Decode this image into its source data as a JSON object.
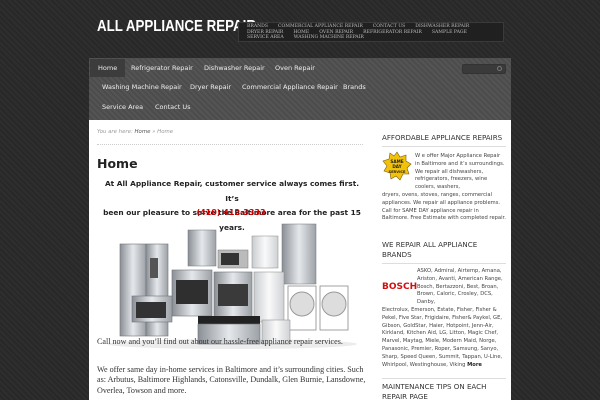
{
  "site": {
    "title": "All Appliance Repair"
  },
  "topnav": [
    "Brands",
    "Commercial Appliance Repair",
    "Contact Us",
    "Dishwasher Repair",
    "Dryer Repair",
    "Home",
    "Oven Repair",
    "Refrigerator Repair",
    "Sample Page",
    "Service Area",
    "Washing Machine Repair"
  ],
  "nav": {
    "items": [
      "Home",
      "Refrigerator Repair",
      "Dishwasher Repair",
      "Oven Repair",
      "Washing Machine Repair",
      "Dryer Repair",
      "Commercial Appliance Repair",
      "Brands",
      "Service Area",
      "Contact Us"
    ],
    "active": "Home"
  },
  "breadcrumb": {
    "prefix": "You are here:",
    "home": "Home",
    "sep": "»",
    "current": "Home"
  },
  "page": {
    "title": "Home",
    "lead1": "At All Appliance Repair, customer service always comes first.  It’s",
    "lead2": "been our pleasure to serve the Baltimore area for the past 15 years.",
    "phone": "(410) 412-3333",
    "p1": "Call now and you’ll find out about our hassle-free appliance repair services.",
    "p2": "We offer same day in-home services in Baltimore and it’s surrounding cities. Such as: Arbutus, Baltimore Highlands, Catonsville, Dundalk, Glen Burnie, Lansdowne, Overlea, Towson and more."
  },
  "sidebar": {
    "w1_title": "Affordable Appliance Repairs",
    "w1_badge": [
      "SAME",
      "DAY",
      "SERVICE"
    ],
    "w1_text_a": "W e offer Major Appliance Repair in Baltimore and it’s surroundings. We repair all dishwashers, refrigerators, freezers, wine coolers, washers,",
    "w1_text_b": "dryers, ovens, stoves, ranges, commercial appliances. We repair all appliance problems. Call for SAME DAY appliance repair in Baltimore. Free Estimate with completed repair.",
    "w2_title_1": "We Repair All Appliance",
    "w2_title_2": "Brands",
    "w2_logo": "BOSCH",
    "w2_text_a": "ASKO, Admiral, Airtemp, Amana, Ariston, Avanti, American Range, Bosch, Bertazzoni, Best, Broan, Brown, Caloric, Crosley, DCS, Danby,",
    "w2_text_b": "Electrolux, Emerson, Estate, Fisher, Fisher & Pekel, Five Star, Frigidaire, Fisher& Paykel, GE, Gibson, GoldStar, Haier, Hotpoint, Jenn-Air, Kirkland, Kitchen Aid, LG, Litton, Magic Chef, Marvel, Maytag, Miele, Modern Maid, Norge, Panasonic, Premier, Roper, Samsung, Sanyo, Sharp, Speed Queen, Summit, Tappan, U-Line, Whirlpool, Westinghouse, Viking",
    "w2_more": "More",
    "w3_title_1": "Maintenance Tips on Each",
    "w3_title_2": "Repair Page"
  }
}
